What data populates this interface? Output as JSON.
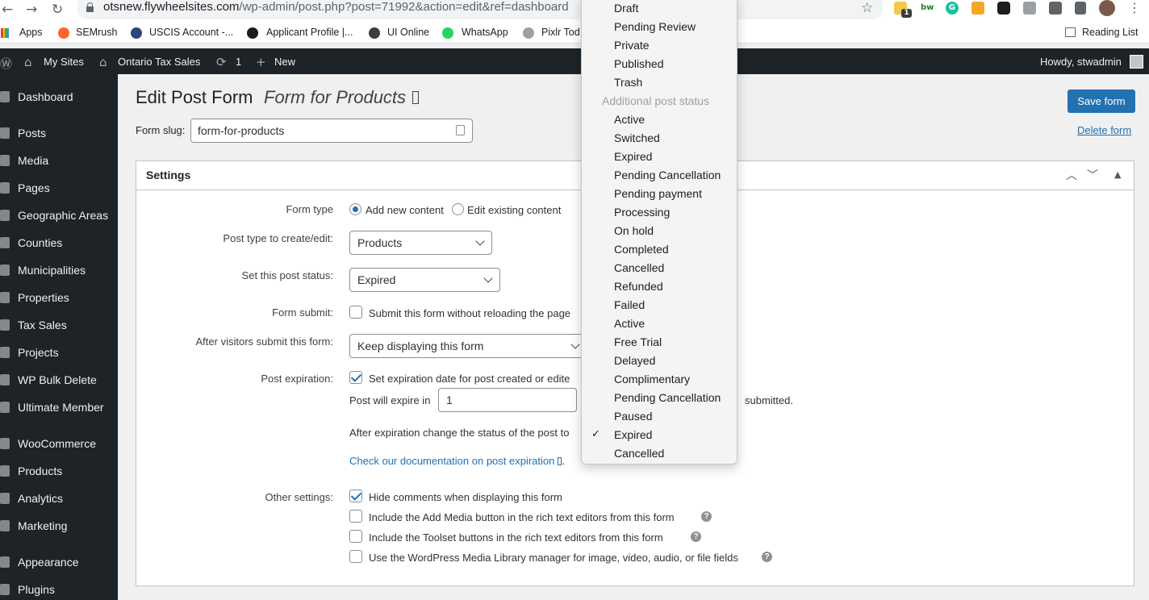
{
  "browser": {
    "url_host": "otsnew.flywheelsites.com",
    "url_path": "/wp-admin/post.php?post=71992&action=edit&ref=dashboard",
    "extension_badge": "1",
    "bookmarks": [
      "Apps",
      "SEMrush",
      "USCIS Account -...",
      "Applicant Profile |...",
      "UI Online",
      "WhatsApp",
      "Pixlr Tod"
    ],
    "reading_list": "Reading List"
  },
  "adminbar": {
    "my_sites": "My Sites",
    "site_name": "Ontario Tax Sales",
    "updates_count": "1",
    "new_label": "New",
    "howdy": "Howdy, stwadmin"
  },
  "sidebar": {
    "items": [
      {
        "label": "Dashboard"
      },
      {
        "label": "Posts"
      },
      {
        "label": "Media"
      },
      {
        "label": "Pages"
      },
      {
        "label": "Geographic Areas"
      },
      {
        "label": "Counties"
      },
      {
        "label": "Municipalities"
      },
      {
        "label": "Properties"
      },
      {
        "label": "Tax Sales"
      },
      {
        "label": "Projects"
      },
      {
        "label": "WP Bulk Delete"
      },
      {
        "label": "Ultimate Member"
      },
      {
        "label": "WooCommerce"
      },
      {
        "label": "Products"
      },
      {
        "label": "Analytics"
      },
      {
        "label": "Marketing"
      },
      {
        "label": "Appearance"
      },
      {
        "label": "Plugins"
      }
    ]
  },
  "header": {
    "title": "Edit Post Form",
    "subtitle": "Form for Products",
    "save_label": "Save form",
    "slug_label": "Form slug:",
    "slug_value": "form-for-products",
    "delete_label": "Delete form"
  },
  "settings": {
    "title": "Settings",
    "form_type": {
      "label": "Form type",
      "options": [
        "Add new content",
        "Edit existing content"
      ],
      "selected": "Add new content"
    },
    "post_type": {
      "label": "Post type to create/edit:",
      "value": "Products"
    },
    "post_status": {
      "label": "Set this post status:",
      "value": "Expired"
    },
    "form_submit": {
      "label": "Form submit:",
      "checkbox_label": "Submit this form without reloading the page",
      "checked": false
    },
    "after_submit": {
      "label": "After visitors submit this form:",
      "value": "Keep displaying this form"
    },
    "post_expiration": {
      "label": "Post expiration:",
      "checkbox_label": "Set expiration date for post created or edite",
      "checked": true,
      "will_expire_label": "Post will expire in",
      "will_expire_value": "1",
      "will_expire_suffix": "submitted.",
      "after_expiration_label": "After expiration change the status of the post to",
      "doc_link": "Check our documentation on post expiration",
      "doc_link_suffix": "."
    },
    "other_settings": {
      "label": "Other settings:",
      "items": [
        {
          "label": "Hide comments when displaying this form",
          "checked": true,
          "help": false
        },
        {
          "label": "Include the Add Media button in the rich text editors from this form",
          "checked": false,
          "help": true
        },
        {
          "label": "Include the Toolset buttons in the rich text editors from this form",
          "checked": false,
          "help": true
        },
        {
          "label": "Use the WordPress Media Library manager for image, video, audio, or file fields",
          "checked": false,
          "help": true
        }
      ]
    }
  },
  "dropdown": {
    "options_top": [
      "Draft",
      "Pending Review",
      "Private",
      "Published",
      "Trash"
    ],
    "group_label": "Additional post status",
    "options_additional": [
      "Active",
      "Switched",
      "Expired",
      "Pending Cancellation",
      "Pending payment",
      "Processing",
      "On hold",
      "Completed",
      "Cancelled",
      "Refunded",
      "Failed",
      "Active",
      "Free Trial",
      "Delayed",
      "Complimentary",
      "Pending Cancellation",
      "Paused",
      "Expired",
      "Cancelled"
    ],
    "selected": "Expired",
    "check_mark": "✓"
  },
  "colors": {
    "wp_blue": "#2271b1",
    "admin_dark": "#1d2327"
  }
}
